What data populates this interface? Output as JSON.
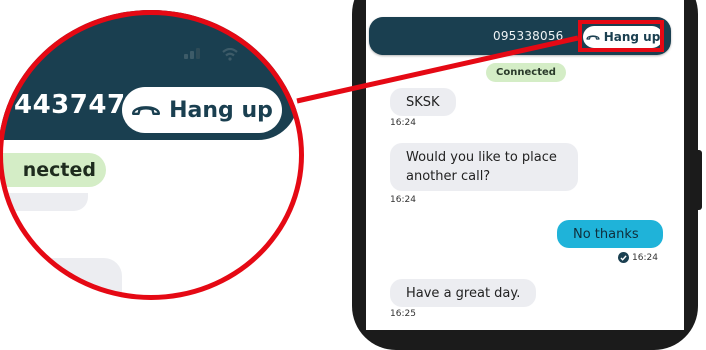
{
  "call": {
    "number": "095338056",
    "hangup_label": "Hang up",
    "status": "Connected"
  },
  "messages": [
    {
      "text": "SKSK",
      "time": "16:24",
      "direction": "in"
    },
    {
      "text": "Would you like to place another call?",
      "time": "16:24",
      "direction": "in"
    },
    {
      "text": "No thanks",
      "time": "16:24",
      "direction": "out"
    },
    {
      "text": "Have a great day.",
      "time": "16:25",
      "direction": "in"
    }
  ],
  "zoom": {
    "number_fragment": "443747",
    "hangup_label": "Hang up",
    "status_fragment": "nected"
  },
  "colors": {
    "header": "#1a3f50",
    "accent_outgoing": "#1fb3d9",
    "status_badge": "#d4edc6",
    "highlight": "#e50914"
  },
  "icons": {
    "hangup": "phone-hangup-icon",
    "read_receipt": "check-circle-icon",
    "signal": "signal-icon",
    "wifi": "wifi-icon"
  }
}
